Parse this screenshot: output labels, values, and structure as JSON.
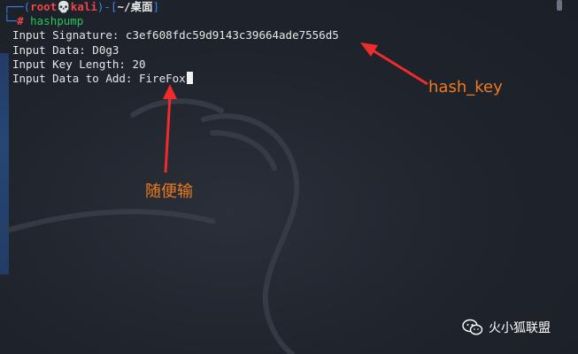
{
  "terminal": {
    "prompt": {
      "user": "root",
      "host": "kali",
      "path": "~/桌面",
      "command": "hashpump"
    },
    "lines": [
      "Input Signature: c3ef608fdc59d9143c39664ade7556d5",
      "Input Data: D0g3",
      "Input Key Length: 20",
      "Input Data to Add: FireFox"
    ]
  },
  "annotations": {
    "hash_key_label": "hash_key",
    "random_input_label": "随便输",
    "color": "#f07a1f"
  },
  "watermark": {
    "text": "火小狐联盟",
    "icon": "wechat-icon"
  },
  "colors": {
    "background": "#1f232b",
    "prompt_blue": "#3b82f6",
    "root_red": "#ef4444",
    "command_green": "#22c55e"
  }
}
